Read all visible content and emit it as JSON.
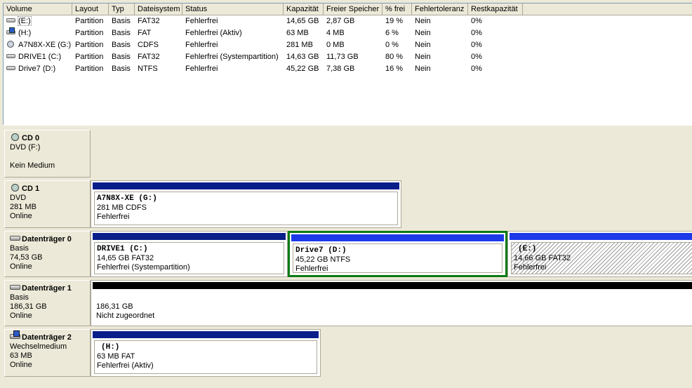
{
  "columns": [
    "Volume",
    "Layout",
    "Typ",
    "Dateisystem",
    "Status",
    "Kapazität",
    "Freier Speicher",
    "% frei",
    "Fehlertoleranz",
    "Restkapazität"
  ],
  "volumes": [
    {
      "icon": "disk-icon",
      "volume": "(E:)",
      "layout": "Partition",
      "typ": "Basis",
      "fs": "FAT32",
      "status": "Fehlerfrei",
      "kap": "14,65 GB",
      "frei": "2,87 GB",
      "pct": "19 %",
      "ft": "Nein",
      "rest": "0%"
    },
    {
      "icon": "removable-drive-icon",
      "volume": "(H:)",
      "layout": "Partition",
      "typ": "Basis",
      "fs": "FAT",
      "status": "Fehlerfrei (Aktiv)",
      "kap": "63 MB",
      "frei": "4 MB",
      "pct": "6 %",
      "ft": "Nein",
      "rest": "0%"
    },
    {
      "icon": "cd-drive-icon",
      "volume": "A7N8X-XE (G:)",
      "layout": "Partition",
      "typ": "Basis",
      "fs": "CDFS",
      "status": "Fehlerfrei",
      "kap": "281 MB",
      "frei": "0 MB",
      "pct": "0 %",
      "ft": "Nein",
      "rest": "0%"
    },
    {
      "icon": "disk-icon",
      "volume": "DRIVE1 (C:)",
      "layout": "Partition",
      "typ": "Basis",
      "fs": "FAT32",
      "status": "Fehlerfrei (Systempartition)",
      "kap": "14,63 GB",
      "frei": "11,73 GB",
      "pct": "80 %",
      "ft": "Nein",
      "rest": "0%"
    },
    {
      "icon": "disk-icon",
      "volume": "Drive7 (D:)",
      "layout": "Partition",
      "typ": "Basis",
      "fs": "NTFS",
      "status": "Fehlerfrei",
      "kap": "45,22 GB",
      "frei": "7,38 GB",
      "pct": "16 %",
      "ft": "Nein",
      "rest": "0%"
    }
  ],
  "disks": {
    "cd0": {
      "name": "CD 0",
      "lines": [
        "DVD (F:)",
        "",
        "Kein Medium"
      ]
    },
    "cd1": {
      "name": "CD 1",
      "lines": [
        "DVD",
        "281 MB",
        "Online"
      ],
      "part": {
        "name": "A7N8X-XE  (G:)",
        "size": "281 MB CDFS",
        "status": "Fehlerfrei"
      }
    },
    "d0": {
      "name": "Datenträger 0",
      "lines": [
        "Basis",
        "74,53 GB",
        "Online"
      ],
      "parts": [
        {
          "name": "DRIVE1  (C:)",
          "size": "14,65 GB FAT32",
          "status": "Fehlerfrei (Systempartition)"
        },
        {
          "name": "Drive7  (D:)",
          "size": "45,22 GB NTFS",
          "status": "Fehlerfrei"
        },
        {
          "name": "(E:)",
          "size": "14,66 GB FAT32",
          "status": "Fehlerfrei"
        }
      ]
    },
    "d1": {
      "name": "Datenträger 1",
      "lines": [
        "Basis",
        "186,31 GB",
        "Online"
      ],
      "part": {
        "size": "186,31 GB",
        "status": "Nicht zugeordnet"
      }
    },
    "d2": {
      "name": "Datenträger 2",
      "lines": [
        "Wechselmedium",
        "63 MB",
        "Online"
      ],
      "part": {
        "name": "(H:)",
        "size": "63 MB FAT",
        "status": "Fehlerfrei (Aktiv)"
      }
    }
  },
  "colors": {
    "primary_bar": "#0a1e8a",
    "logical_bar": "#1c3ae8",
    "unallocated_bar": "#000000",
    "selection": "#0a7a14"
  }
}
